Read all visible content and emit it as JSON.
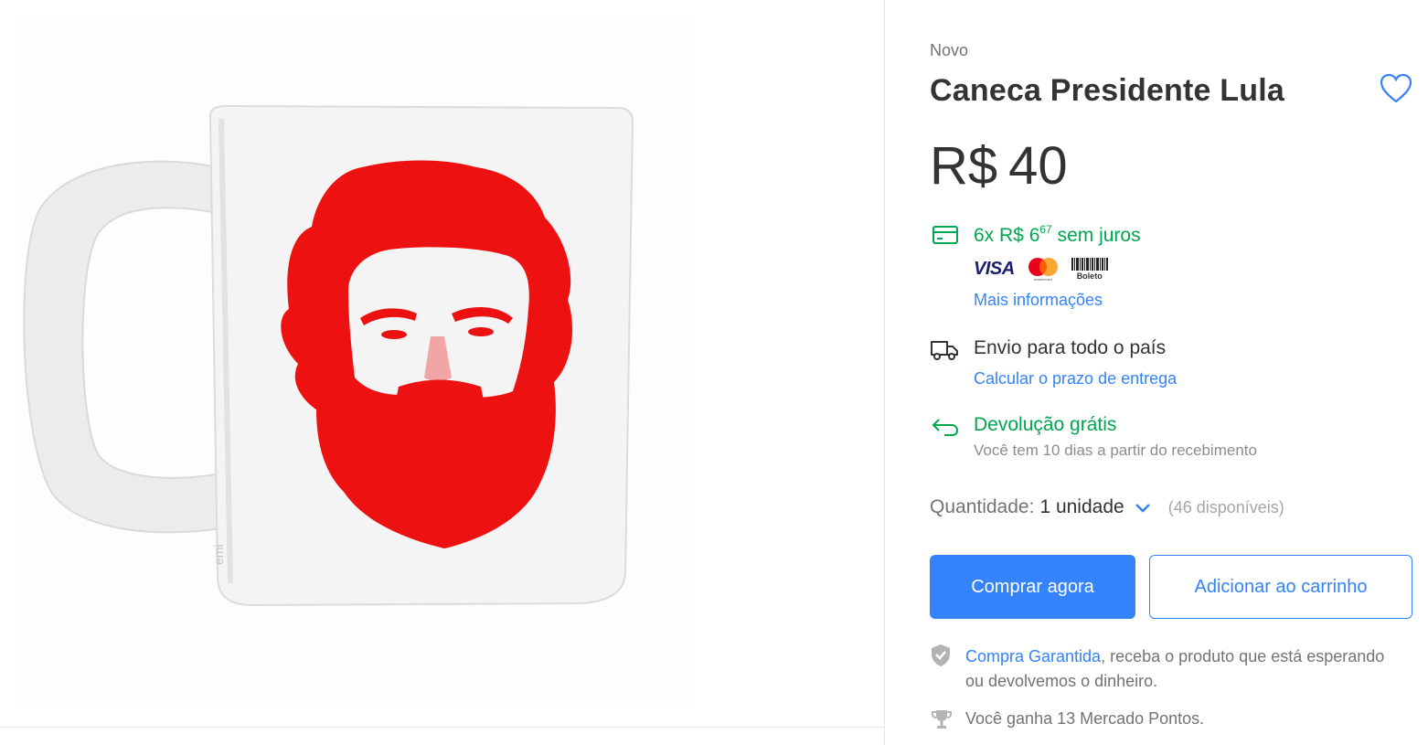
{
  "product": {
    "condition": "Novo",
    "title": "Caneca Presidente Lula",
    "price_currency": "R$",
    "price_value": "40",
    "image_watermark": "emi"
  },
  "payment": {
    "installments_prefix": "6x R$ 6",
    "installments_cents": "67",
    "installments_suffix": " sem juros",
    "methods": [
      "VISA",
      "mastercard",
      "Boleto"
    ],
    "more_info_link": "Mais informações"
  },
  "shipping": {
    "title": "Envio para todo o país",
    "link": "Calcular o prazo de entrega"
  },
  "returns": {
    "title": "Devolução grátis",
    "subtitle": "Você tem 10 dias a partir do recebimento"
  },
  "quantity": {
    "label": "Quantidade:",
    "value": "1 unidade",
    "available": "(46 disponíveis)"
  },
  "actions": {
    "buy_now": "Comprar agora",
    "add_to_cart": "Adicionar ao carrinho"
  },
  "guarantee": {
    "link": "Compra Garantida",
    "text": ", receba o produto que está esperando ou devolvemos o dinheiro."
  },
  "points": {
    "text": "Você ganha 13 Mercado Pontos."
  },
  "colors": {
    "accent": "#3483fa",
    "success": "#00a650",
    "text": "#333333",
    "muted": "#737373",
    "print_red": "#ee1111"
  }
}
